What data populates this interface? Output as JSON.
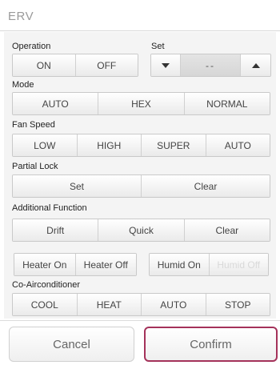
{
  "window": {
    "title": "ERV"
  },
  "operation": {
    "label": "Operation",
    "buttons": [
      "ON",
      "OFF"
    ]
  },
  "set": {
    "label": "Set",
    "value": "--"
  },
  "mode": {
    "label": "Mode",
    "buttons": [
      "AUTO",
      "HEX",
      "NORMAL"
    ]
  },
  "fan_speed": {
    "label": "Fan Speed",
    "buttons": [
      "LOW",
      "HIGH",
      "SUPER",
      "AUTO"
    ]
  },
  "partial_lock": {
    "label": "Partial Lock",
    "buttons": [
      "Set",
      "Clear"
    ]
  },
  "additional_function": {
    "label": "Additional Function",
    "buttons": [
      "Drift",
      "Quick",
      "Clear"
    ]
  },
  "heater": {
    "buttons": [
      "Heater On",
      "Heater Off"
    ]
  },
  "humid": {
    "buttons": [
      "Humid On",
      "Humid Off"
    ]
  },
  "co_airconditioner": {
    "label": "Co-Airconditioner",
    "buttons": [
      "COOL",
      "HEAT",
      "AUTO",
      "STOP"
    ]
  },
  "footer": {
    "cancel": "Cancel",
    "confirm": "Confirm"
  },
  "colors": {
    "confirm_border": "#a4325a",
    "disabled_text": "#d9d9d9"
  },
  "icons": {
    "decrease": "triangle-down-icon",
    "increase": "triangle-up-icon"
  }
}
